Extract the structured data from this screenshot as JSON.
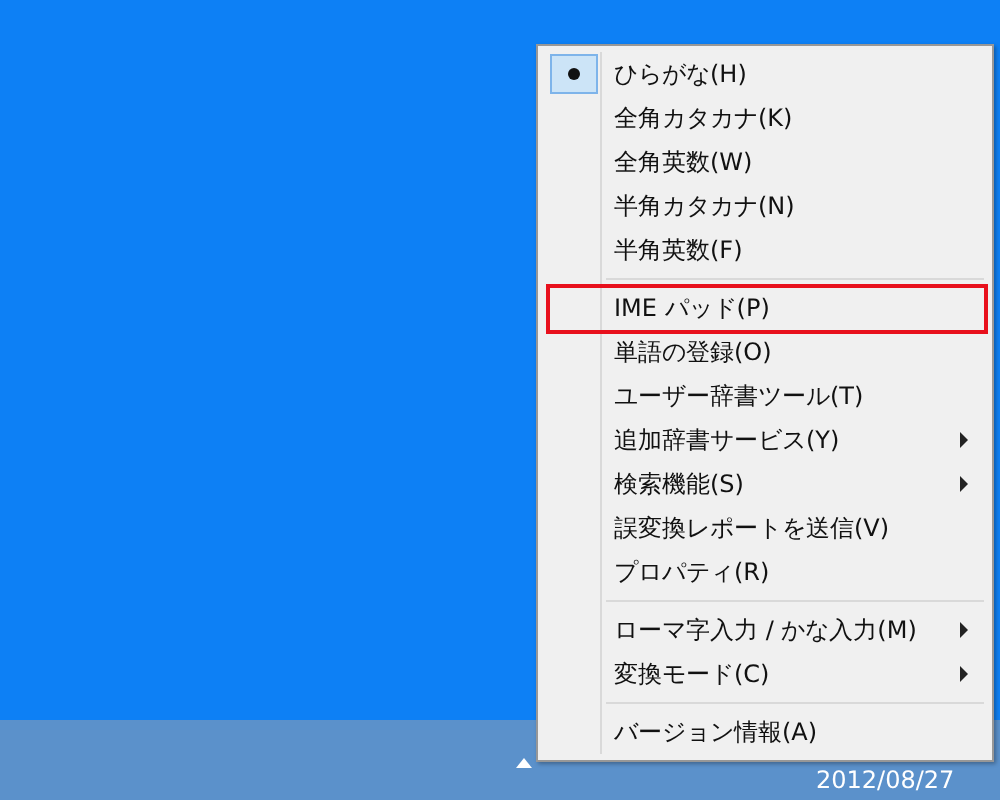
{
  "menu": {
    "items": [
      {
        "kind": "item",
        "label": "ひらがな(H)",
        "checked": true,
        "submenu": false,
        "highlighted": false
      },
      {
        "kind": "item",
        "label": "全角カタカナ(K)",
        "checked": false,
        "submenu": false,
        "highlighted": false
      },
      {
        "kind": "item",
        "label": "全角英数(W)",
        "checked": false,
        "submenu": false,
        "highlighted": false
      },
      {
        "kind": "item",
        "label": "半角カタカナ(N)",
        "checked": false,
        "submenu": false,
        "highlighted": false
      },
      {
        "kind": "item",
        "label": "半角英数(F)",
        "checked": false,
        "submenu": false,
        "highlighted": false
      },
      {
        "kind": "separator"
      },
      {
        "kind": "item",
        "label": "IME パッド(P)",
        "checked": false,
        "submenu": false,
        "highlighted": true
      },
      {
        "kind": "item",
        "label": "単語の登録(O)",
        "checked": false,
        "submenu": false,
        "highlighted": false
      },
      {
        "kind": "item",
        "label": "ユーザー辞書ツール(T)",
        "checked": false,
        "submenu": false,
        "highlighted": false
      },
      {
        "kind": "item",
        "label": "追加辞書サービス(Y)",
        "checked": false,
        "submenu": true,
        "highlighted": false
      },
      {
        "kind": "item",
        "label": "検索機能(S)",
        "checked": false,
        "submenu": true,
        "highlighted": false
      },
      {
        "kind": "item",
        "label": "誤変換レポートを送信(V)",
        "checked": false,
        "submenu": false,
        "highlighted": false
      },
      {
        "kind": "item",
        "label": "プロパティ(R)",
        "checked": false,
        "submenu": false,
        "highlighted": false
      },
      {
        "kind": "separator"
      },
      {
        "kind": "item",
        "label": "ローマ字入力 / かな入力(M)",
        "checked": false,
        "submenu": true,
        "highlighted": false
      },
      {
        "kind": "item",
        "label": "変換モード(C)",
        "checked": false,
        "submenu": true,
        "highlighted": false
      },
      {
        "kind": "separator"
      },
      {
        "kind": "item",
        "label": "バージョン情報(A)",
        "checked": false,
        "submenu": false,
        "highlighted": false
      }
    ]
  },
  "taskbar": {
    "clock_date": "2012/08/27"
  }
}
